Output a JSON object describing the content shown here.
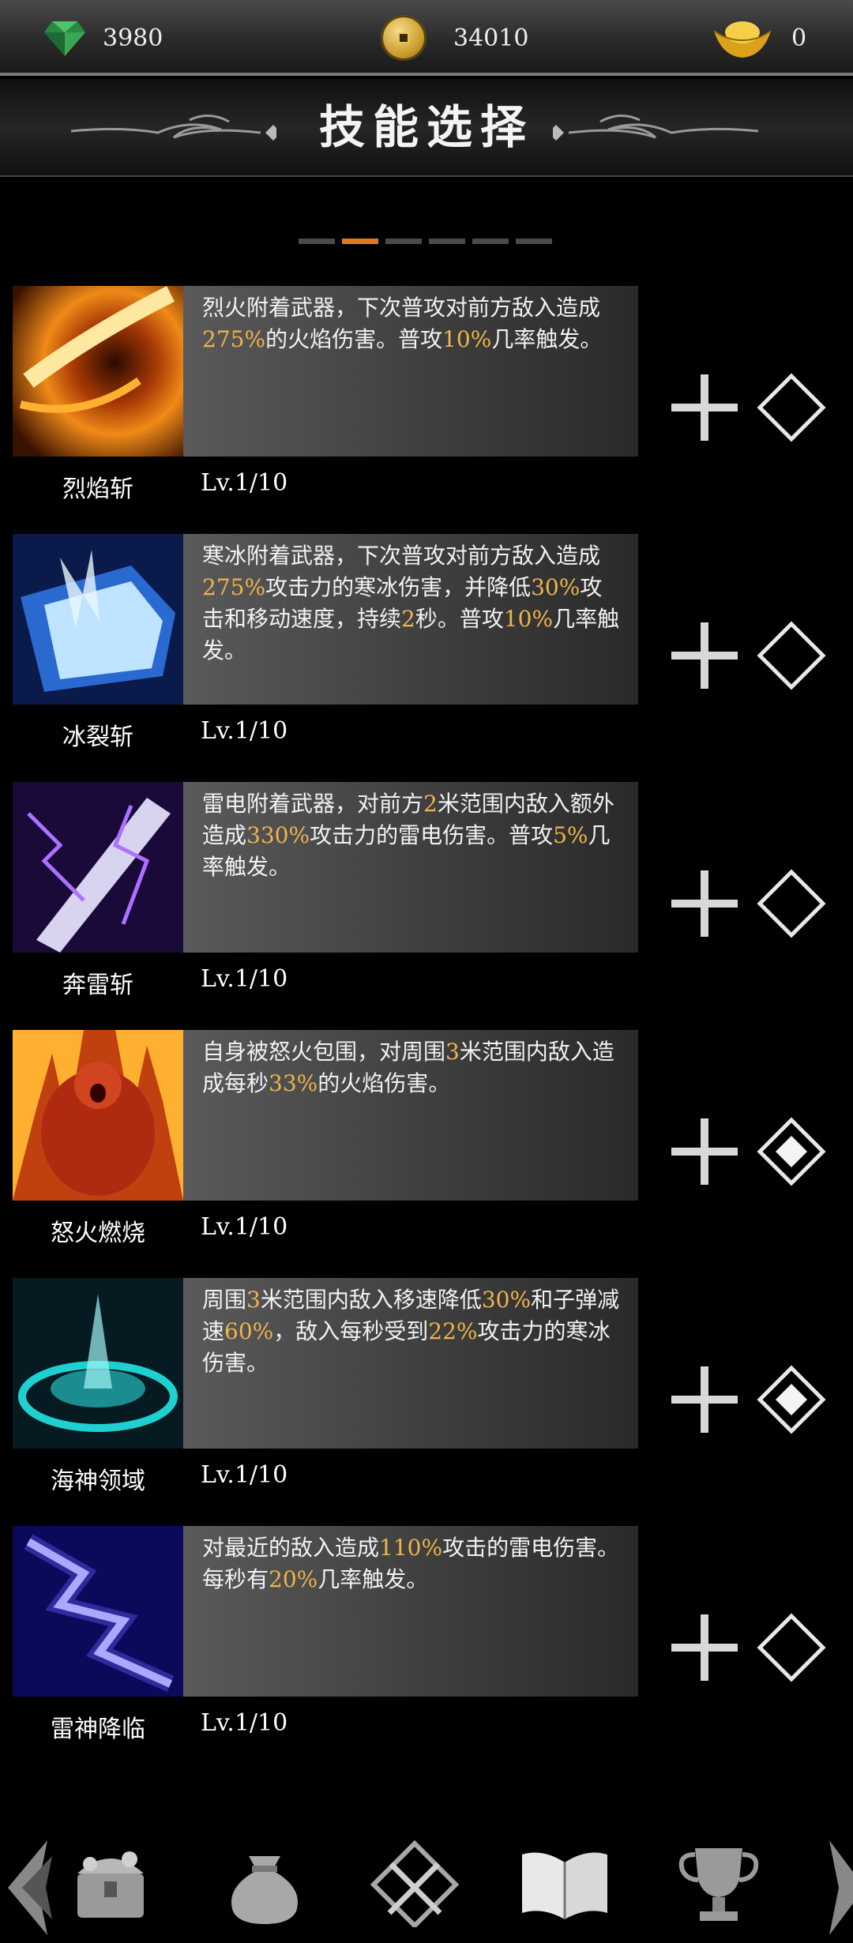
{
  "currency": {
    "gems": "3980",
    "coins": "34010",
    "ingots": "0"
  },
  "header": {
    "title": "技能选择"
  },
  "pager": {
    "count": 6,
    "active_index": 1
  },
  "skills": [
    {
      "name": "烈焰斩",
      "level": "Lv.1/10",
      "icon": "flame-slash-icon",
      "desc": [
        [
          "烈火附着武器，下次普攻对前方敌入造成",
          false
        ],
        [
          "275%",
          true
        ],
        [
          "的火焰伤害。普攻",
          false
        ],
        [
          "10%",
          true
        ],
        [
          "几率触发。",
          false
        ]
      ],
      "equipped": false
    },
    {
      "name": "冰裂斩",
      "level": "Lv.1/10",
      "icon": "ice-slash-icon",
      "desc": [
        [
          "寒冰附着武器，下次普攻对前方敌入造成",
          false
        ],
        [
          "275%",
          true
        ],
        [
          "攻击力的寒冰伤害，并降低",
          false
        ],
        [
          "30%",
          true
        ],
        [
          "攻击和移动速度，持续",
          false
        ],
        [
          "2",
          true
        ],
        [
          "秒。普攻",
          false
        ],
        [
          "10%",
          true
        ],
        [
          "几率触发。",
          false
        ]
      ],
      "equipped": false
    },
    {
      "name": "奔雷斩",
      "level": "Lv.1/10",
      "icon": "thunder-slash-icon",
      "desc": [
        [
          "雷电附着武器，对前方",
          false
        ],
        [
          "2",
          true
        ],
        [
          "米范围内敌入额外造成",
          false
        ],
        [
          "330%",
          true
        ],
        [
          "攻击力的雷电伤害。普攻",
          false
        ],
        [
          "5%",
          true
        ],
        [
          "几率触发。",
          false
        ]
      ],
      "equipped": false
    },
    {
      "name": "怒火燃烧",
      "level": "Lv.1/10",
      "icon": "rage-fire-icon",
      "desc": [
        [
          "自身被怒火包围，对周围",
          false
        ],
        [
          "3",
          true
        ],
        [
          "米范围内敌入造成每秒",
          false
        ],
        [
          "33%",
          true
        ],
        [
          "的火焰伤害。",
          false
        ]
      ],
      "equipped": true
    },
    {
      "name": "海神领域",
      "level": "Lv.1/10",
      "icon": "sea-domain-icon",
      "desc": [
        [
          "周围",
          false
        ],
        [
          "3",
          true
        ],
        [
          "米范围内敌入移速降低",
          false
        ],
        [
          "30%",
          true
        ],
        [
          "和子弹减速",
          false
        ],
        [
          "60%",
          true
        ],
        [
          "，敌入每秒受到",
          false
        ],
        [
          "22%",
          true
        ],
        [
          "攻击力的寒冰伤害。",
          false
        ]
      ],
      "equipped": true
    },
    {
      "name": "雷神降临",
      "level": "Lv.1/10",
      "icon": "thunder-god-icon",
      "desc": [
        [
          "对最近的敌入造成",
          false
        ],
        [
          "110%",
          true
        ],
        [
          "攻击的雷电伤害。每秒有",
          false
        ],
        [
          "20%",
          true
        ],
        [
          "几率触发。",
          false
        ]
      ],
      "equipped": false
    }
  ],
  "bottom_nav": [
    "treasure-chest-icon",
    "money-bag-icon",
    "crossed-swords-icon",
    "open-book-icon",
    "trophy-icon"
  ],
  "colors": {
    "accent": "#e07a20",
    "highlight": "#f0b44a"
  }
}
